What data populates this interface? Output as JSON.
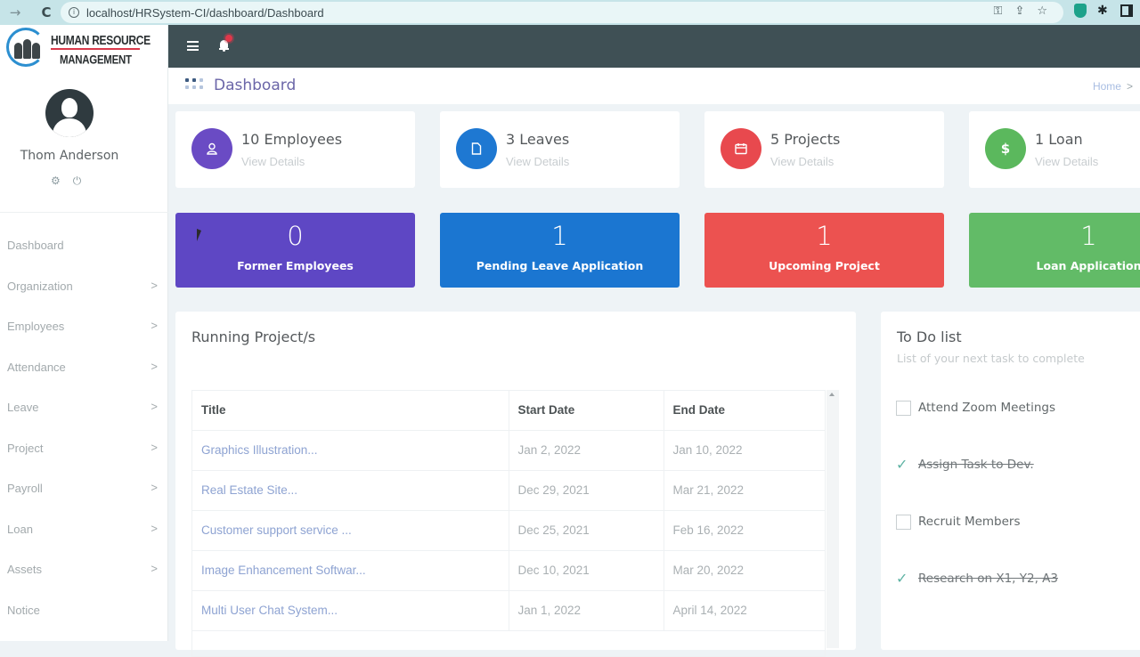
{
  "browser": {
    "url": "localhost/HRSystem-CI/dashboard/Dashboard"
  },
  "brand": {
    "line1": "HUMAN RESOURCE",
    "line2": "MANAGEMENT"
  },
  "user": {
    "name": "Thom Anderson"
  },
  "sidebar": {
    "items": [
      {
        "label": "Dashboard",
        "has_children": false
      },
      {
        "label": "Organization",
        "has_children": true
      },
      {
        "label": "Employees",
        "has_children": true
      },
      {
        "label": "Attendance",
        "has_children": true
      },
      {
        "label": "Leave",
        "has_children": true
      },
      {
        "label": "Project",
        "has_children": true
      },
      {
        "label": "Payroll",
        "has_children": true
      },
      {
        "label": "Loan",
        "has_children": true
      },
      {
        "label": "Assets",
        "has_children": true
      },
      {
        "label": "Notice",
        "has_children": false
      }
    ]
  },
  "header": {
    "title": "Dashboard",
    "breadcrumb": "Home"
  },
  "info_cards": [
    {
      "title": "10 Employees",
      "link": "View Details",
      "icon": "user-icon",
      "color": "#6a4bc4"
    },
    {
      "title": "3 Leaves",
      "link": "View Details",
      "icon": "file-icon",
      "color": "#1e78d2"
    },
    {
      "title": "5 Projects",
      "link": "View Details",
      "icon": "calendar-icon",
      "color": "#e8494e"
    },
    {
      "title": "1 Loan",
      "link": "View Details",
      "icon": "dollar-icon",
      "color": "#5bb85d"
    }
  ],
  "stat_tiles": [
    {
      "value": "0",
      "label": "Former Employees",
      "color": "#5e47c4"
    },
    {
      "value": "1",
      "label": "Pending Leave Application",
      "color": "#1b76d1"
    },
    {
      "value": "1",
      "label": "Upcoming Project",
      "color": "#ec5250"
    },
    {
      "value": "1",
      "label": "Loan Application",
      "color": "#62bb67"
    }
  ],
  "projects": {
    "title": "Running Project/s",
    "columns": [
      "Title",
      "Start Date",
      "End Date"
    ],
    "rows": [
      [
        "Graphics Illustration...",
        "Jan 2, 2022",
        "Jan 10, 2022"
      ],
      [
        "Real Estate Site...",
        "Dec 29, 2021",
        "Mar 21, 2022"
      ],
      [
        "Customer support service ...",
        "Dec 25, 2021",
        "Feb 16, 2022"
      ],
      [
        "Image Enhancement Softwar...",
        "Dec 10, 2021",
        "Mar 20, 2022"
      ],
      [
        "Multi User Chat System...",
        "Jan 1, 2022",
        "April 14, 2022"
      ]
    ]
  },
  "todo": {
    "title": "To Do list",
    "subtitle": "List of your next task to complete",
    "items": [
      {
        "text": "Attend Zoom Meetings",
        "done": false
      },
      {
        "text": "Assign Task to Dev.",
        "done": true
      },
      {
        "text": "Recruit Members",
        "done": false
      },
      {
        "text": "Research on X1, Y2, A3",
        "done": true
      }
    ]
  }
}
